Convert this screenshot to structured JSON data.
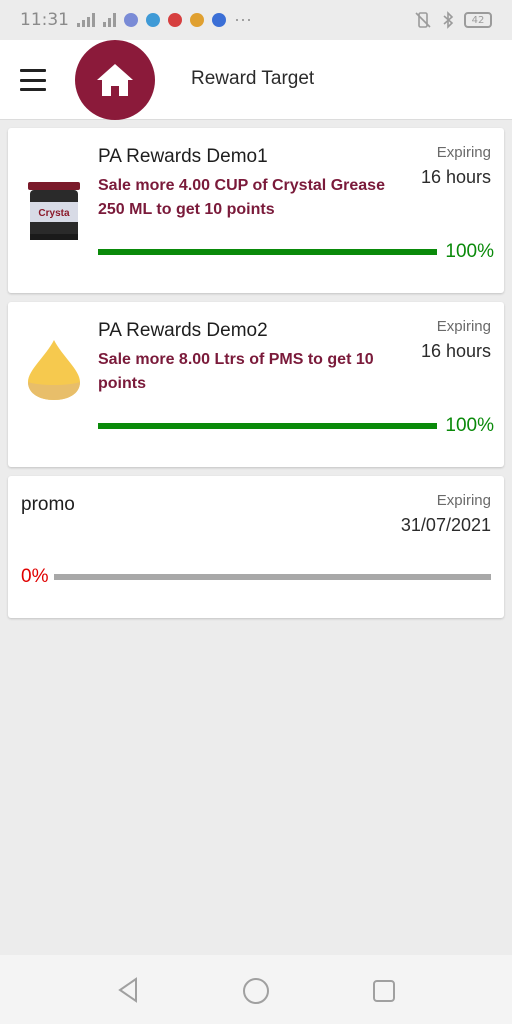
{
  "status_bar": {
    "time": "11:31",
    "battery": "42"
  },
  "app_bar": {
    "title": "Reward Target"
  },
  "rewards": [
    {
      "title": "PA Rewards Demo1",
      "description": "Sale more 4.00 CUP of Crystal Grease 250 ML to get 10 points",
      "expiry_label": "Expiring",
      "expiry_value": "16 hours",
      "progress_text": "100%",
      "progress": 1.0,
      "icon": "crystal-grease-jar-icon"
    },
    {
      "title": "PA Rewards Demo2",
      "description": "Sale more 8.00 Ltrs of PMS to get 10 points",
      "expiry_label": "Expiring",
      "expiry_value": "16 hours",
      "progress_text": "100%",
      "progress": 1.0,
      "icon": "fuel-drop-icon"
    },
    {
      "title": "promo",
      "expiry_label": "Expiring",
      "expiry_value": "31/07/2021",
      "progress_text": "0%",
      "progress": 0.0
    }
  ],
  "colors": {
    "brand": "#8b1a3a",
    "description": "#7a1a3a",
    "progress_complete": "#0a8a0a",
    "progress_zero_text": "#e00000",
    "track": "#a8a8a8"
  }
}
